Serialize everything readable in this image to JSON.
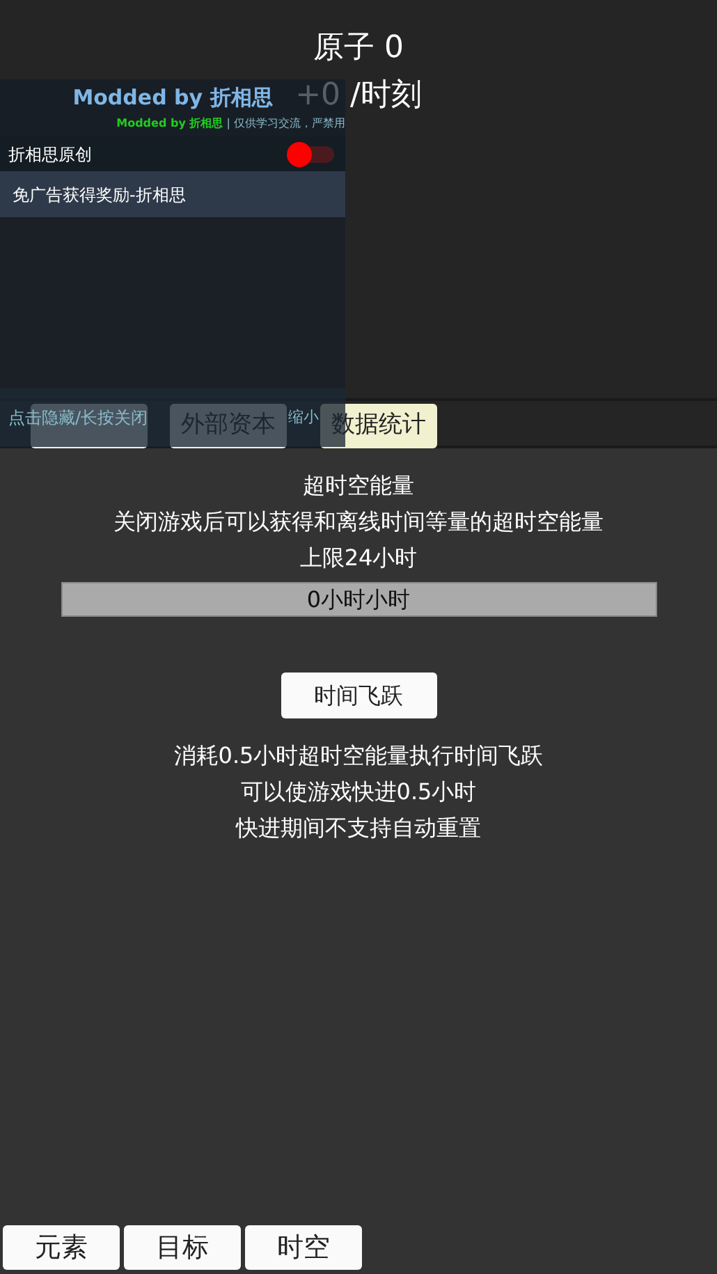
{
  "header": {
    "title": "原子 0",
    "rate": "+0 /时刻"
  },
  "top_buttons": [
    {
      "kind": "blank"
    },
    {
      "kind": "labeled",
      "label": "外部资本"
    },
    {
      "kind": "highlight",
      "label": "数据统计"
    }
  ],
  "panel": {
    "title": "超时空能量",
    "description": "关闭游戏后可以获得和离线时间等量的超时空能量",
    "limit": "上限24小时",
    "progress": {
      "level": 0,
      "reading": "0小时小时"
    },
    "action": "时间飞跃",
    "notes": [
      "消耗0.5小时超时空能量执行时间飞跃",
      "可以使游戏快进0.5小时",
      "快进期间不支持自动重置"
    ]
  },
  "bottom_tabs": [
    {
      "label": "元素"
    },
    {
      "label": "目标"
    },
    {
      "label": "时空"
    }
  ],
  "mod_menu": {
    "title": "Modded by 折相思",
    "credit": "Modded by 折相思",
    "notice": "| 仅供学习交流，严禁用",
    "toggle": {
      "label": "折相思原创",
      "on": false
    },
    "items": [
      "免广告获得奖励-折相思"
    ],
    "hide_hint": "点击隐藏/长按关闭",
    "minimize": "缩小"
  }
}
